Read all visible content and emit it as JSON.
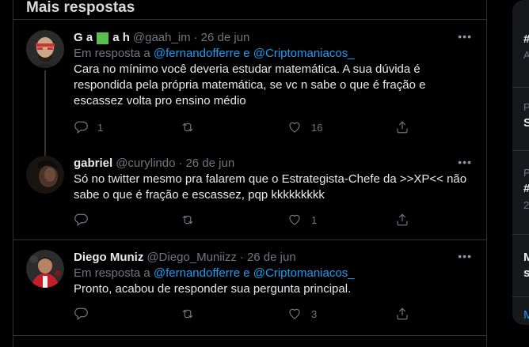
{
  "section_title": "Mais respostas",
  "tweets": [
    {
      "name_first": "G a",
      "name_last": "a h",
      "handle": "@gaah_im",
      "date": "26 de jun",
      "reply_prefix": "Em resposta a",
      "reply_user1": "@fernandofferre",
      "reply_and": "e",
      "reply_user2": "@Criptomaniacos_",
      "text": "Cara no mínimo você deveria estudar matemática. A sua dúvida é respondida pela própria matemática, se vc n sabe o que é fração e escassez volta pro ensino médio",
      "replies": "1",
      "retweets": "",
      "likes": "16"
    },
    {
      "name": "gabriel",
      "handle": "@curylindo",
      "date": "26 de jun",
      "text": "Só no twitter mesmo pra falarem que o Estrategista-Chefe da >>XP<< não sabe o que é fração e escassez, pqp kkkkkkkkk",
      "replies": "",
      "retweets": "",
      "likes": "1"
    },
    {
      "name": "Diego Muniz",
      "handle": "@Diego_Muniizz",
      "date": "26 de jun",
      "reply_prefix": "Em resposta a",
      "reply_user1": "@fernandofferre",
      "reply_and": "e",
      "reply_user2": "@Criptomaniacos_",
      "text": "Pronto, acabou de responder sua pergunta principal.",
      "replies": "",
      "retweets": "",
      "likes": "3"
    }
  ],
  "more_label": "•••",
  "right_sidebar": [
    "#",
    "A",
    "P",
    "S",
    "P",
    "#",
    "2",
    "M",
    "s",
    "M"
  ],
  "colors": {
    "background": "#000000",
    "link": "#1d9bf0",
    "muted": "#71767b",
    "text": "#e7e9ea",
    "name_block": "#5bbd4d"
  }
}
